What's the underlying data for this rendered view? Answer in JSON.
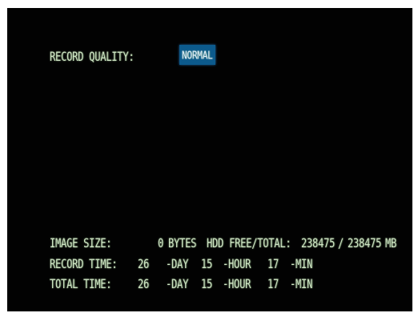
{
  "record_quality": {
    "label": "RECORD QUALITY:",
    "value": "NORMAL"
  },
  "image_size": {
    "label": "IMAGE SIZE:",
    "value": "0",
    "unit": "BYTES"
  },
  "hdd": {
    "label": "HDD FREE/TOTAL:",
    "free": "238475",
    "separator": "/",
    "total": "238475",
    "unit": "MB"
  },
  "record_time": {
    "label": "RECORD TIME:",
    "days": "26",
    "day_unit": "-DAY",
    "hours": "15",
    "hour_unit": "-HOUR",
    "minutes": "17",
    "min_unit": "-MIN"
  },
  "total_time": {
    "label": "TOTAL TIME:",
    "days": "26",
    "day_unit": "-DAY",
    "hours": "15",
    "hour_unit": "-HOUR",
    "minutes": "17",
    "min_unit": "-MIN"
  },
  "colors": {
    "screen_bg": "#020202",
    "text": "#cfe6c4",
    "highlight": "#0c5a8c"
  }
}
